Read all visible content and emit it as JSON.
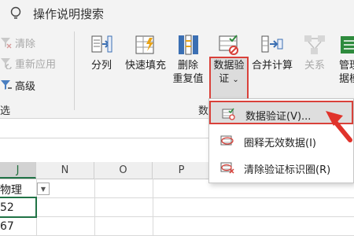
{
  "titlebar": {
    "search_label": "操作说明搜索"
  },
  "sort_filter": {
    "clear_label": "清除",
    "reapply_label": "重新应用",
    "advanced_label": "高级",
    "group_label_fragment": "选"
  },
  "data_tools": {
    "split_columns": "分列",
    "flash_fill": "快速填充",
    "remove_duplicates_line1": "删除",
    "remove_duplicates_line2": "重复值",
    "data_validation_line1": "数据验",
    "data_validation_line2": "证",
    "data_validation_chevron": "⌄",
    "consolidate": "合并计算",
    "relationships": "关系",
    "manage_model_line1": "管理",
    "manage_model_line2": "据模",
    "group_label_fragment": "数"
  },
  "columns": {
    "selected": "J",
    "headers": [
      "N",
      "O",
      "P"
    ]
  },
  "cells": {
    "header": "物理",
    "row1": "52",
    "row2": "67"
  },
  "dropdown": {
    "items": [
      {
        "label": "数据验证(V)...",
        "icon": "validation-icon"
      },
      {
        "label": "圈释无效数据(I)",
        "icon": "circle-invalid-icon"
      },
      {
        "label": "清除验证标识圈(R)",
        "icon": "clear-circles-icon"
      }
    ]
  },
  "colors": {
    "highlight": "#d9413a",
    "accent_green": "#217346",
    "ribbon_bg": "#f3f3f3"
  }
}
